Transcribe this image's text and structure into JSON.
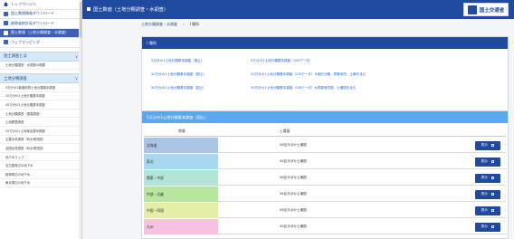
{
  "sidebar": {
    "items": [
      {
        "label": "トップページへ",
        "icon": "home-icon",
        "active": false
      },
      {
        "label": "国土数値情報ダウンロード",
        "icon": "folder-icon",
        "active": false
      },
      {
        "label": "総務省統計局ダウンロード",
        "icon": "folder-icon",
        "active": false
      },
      {
        "label": "国土数値（土地分類調査・水調査）",
        "icon": "folder-icon",
        "active": true
      },
      {
        "label": "ウェブマッピング",
        "icon": "map-icon",
        "active": false
      }
    ],
    "section1": {
      "label": "国土調査とは"
    },
    "section1_items": [
      "土地分類調査・水調査の概要"
    ],
    "section2": {
      "label": "土地分類調査"
    },
    "section2_items": [
      "5万分の1都道府県土地分類基本調査",
      "20万分の1土地分類基本調査",
      "50万分の1土地分類基本調査",
      "土地分類調査（垂直調査）",
      "土地履歴調査",
      "20万分の1土地保全基本調査",
      "主要水系調査（利水現況図）",
      "全国水質調査（利水現況図）",
      "地下水マップ",
      "名古屋周辺の地下水",
      "阪神周辺の地下水",
      "東京周辺の地下水"
    ]
  },
  "header": {
    "title": "国土数値（土地分類調査・水調査）",
    "logo_text": "国土交通省"
  },
  "breadcrumb": {
    "parent": "土地分類調査・水調査",
    "current": "I 場所"
  },
  "index_card": {
    "title": "I 場所",
    "links": [
      "5万分の1土地分類基本調査（国土）",
      "5万分の1土地分類基本調査（GISデータ）",
      "20万分の1土地分類基本調査（国土）",
      "20万分の1土地分類基本調査（GISデータ）※地形分類、表層地質、土壌を含む",
      "50万分の1土地分類基本調査（国土）",
      "50万分の1土地分類基本調査（GISデータ）※表層地質図、土壌図を含む"
    ]
  },
  "table_card": {
    "title": "5万分の1土地分類基本調査（国土）",
    "col_region": "地域",
    "col_prod": "土壌図",
    "rows": [
      {
        "region": "北海道",
        "prod": "56区分ほか土壌図",
        "button": "表示",
        "color": "#a9c4e4"
      },
      {
        "region": "東北",
        "prod": "56区分ほか土壌図",
        "button": "表示",
        "color": "#a8d7f0"
      },
      {
        "region": "関東・中部",
        "prod": "56区分ほか土壌図",
        "button": "表示",
        "color": "#b3e3d9"
      },
      {
        "region": "中部・近畿",
        "prod": "56区分ほか土壌図",
        "button": "表示",
        "color": "#b8e6a0"
      },
      {
        "region": "中国・四国",
        "prod": "56区分ほか土壌図",
        "button": "表示",
        "color": "#e6eda5"
      },
      {
        "region": "九州",
        "prod": "56区分ほか土壌図",
        "button": "表示",
        "color": "#f6c2dd"
      }
    ]
  }
}
